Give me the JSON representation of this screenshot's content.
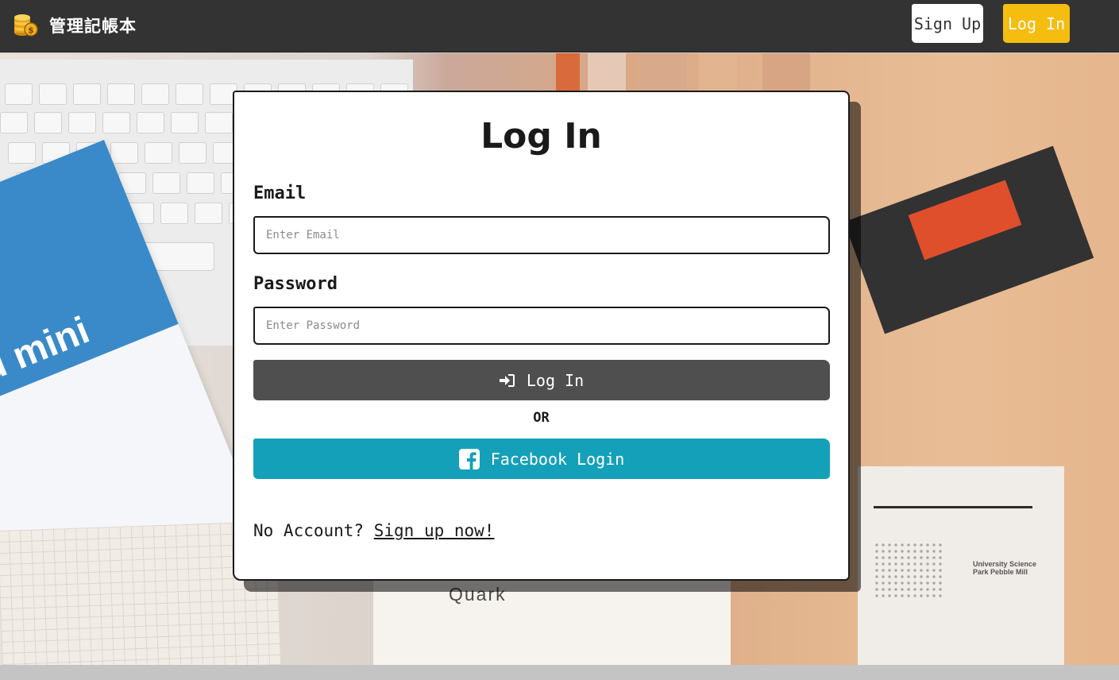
{
  "navbar": {
    "brand": "管理記帳本",
    "brand_icon": "coin-stack-icon",
    "signup_label": "Sign Up",
    "login_label": "Log In",
    "login_color": "#f5bd0f"
  },
  "background": {
    "magazine_text": "d mini",
    "brochure_text": "Quark",
    "report_text": "University Science Park Pebble Mill"
  },
  "modal": {
    "title": "Log In",
    "email_label": "Email",
    "email_placeholder": "Enter Email",
    "password_label": "Password",
    "password_placeholder": "Enter Password",
    "login_button": "Log In",
    "login_icon": "sign-in-icon",
    "or_text": "OR",
    "facebook_button": "Facebook Login",
    "facebook_icon": "facebook-icon",
    "facebook_color": "#15a0b9",
    "no_account_text": "No Account?",
    "signup_link": "Sign up now!"
  }
}
